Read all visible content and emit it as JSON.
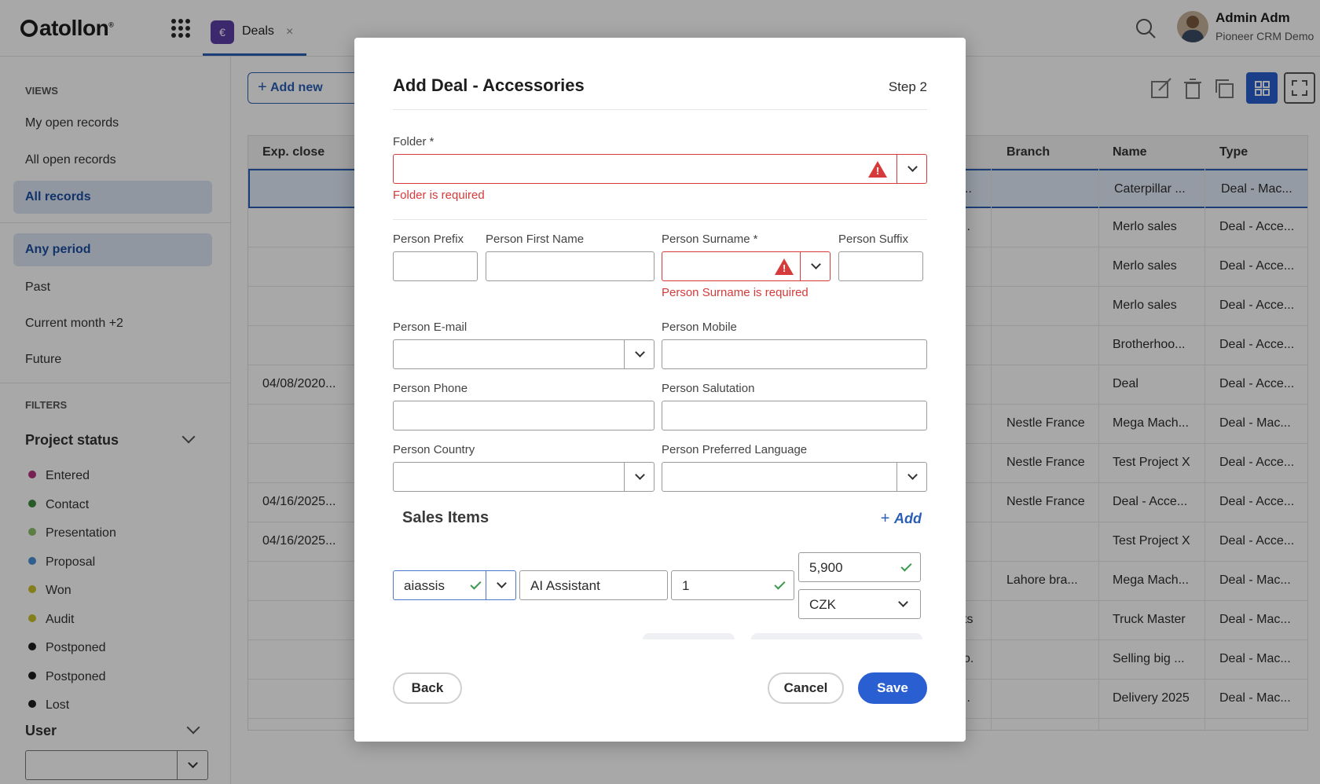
{
  "app": {
    "logo": "atollon",
    "logo_mark": "®",
    "tab_label": "Deals",
    "tab_close": "×",
    "tab_icon_glyph": "€"
  },
  "user": {
    "name": "Admin Adm",
    "org": "Pioneer CRM Demo"
  },
  "sidebar": {
    "views_heading": "VIEWS",
    "views": [
      "My open records",
      "All open records",
      "All records"
    ],
    "period_items": [
      "Any period",
      "Past",
      "Current month +2",
      "Future"
    ],
    "filters_heading": "FILTERS",
    "project_status_title": "Project status",
    "statuses": [
      {
        "label": "Entered",
        "color": "#b5317f"
      },
      {
        "label": "Contact",
        "color": "#3f8a3f"
      },
      {
        "label": "Presentation",
        "color": "#8cc06a"
      },
      {
        "label": "Proposal",
        "color": "#4a90d9"
      },
      {
        "label": "Won",
        "color": "#c9c02a"
      },
      {
        "label": "Audit",
        "color": "#c9c02a"
      },
      {
        "label": "Postponed",
        "color": "#1d1d1d"
      },
      {
        "label": "Postponed",
        "color": "#1d1d1d"
      },
      {
        "label": "Lost",
        "color": "#1d1d1d"
      }
    ],
    "user_filter_title": "User"
  },
  "main": {
    "add_new_label": "Add new",
    "table": {
      "headers": {
        "exp_close": "Exp. close",
        "branch": "Branch",
        "name": "Name",
        "type": "Type"
      },
      "rows": [
        {
          "exp_close": "",
          "mid": "..",
          "branch": "",
          "name": "Caterpillar ...",
          "type": "Deal - Mac..."
        },
        {
          "exp_close": "",
          "mid": "..",
          "branch": "",
          "name": "Merlo sales",
          "type": "Deal - Acce..."
        },
        {
          "exp_close": "",
          "mid": "",
          "branch": "",
          "name": "Merlo sales",
          "type": "Deal - Acce..."
        },
        {
          "exp_close": "",
          "mid": ".",
          "branch": "",
          "name": "Merlo sales",
          "type": "Deal - Acce..."
        },
        {
          "exp_close": "",
          "mid": "",
          "branch": "",
          "name": "Brotherhoo...",
          "type": "Deal - Acce..."
        },
        {
          "exp_close": "04/08/2020...",
          "mid": "",
          "branch": "",
          "name": "Deal",
          "type": "Deal - Acce..."
        },
        {
          "exp_close": "",
          "mid": "",
          "branch": "Nestle France",
          "name": "Mega Mach...",
          "type": "Deal - Mac..."
        },
        {
          "exp_close": "",
          "mid": "",
          "branch": "Nestle France",
          "name": "Test Project X",
          "type": "Deal - Acce..."
        },
        {
          "exp_close": "04/16/2025...",
          "mid": "",
          "branch": "Nestle France",
          "name": "Deal - Acce...",
          "type": "Deal - Acce..."
        },
        {
          "exp_close": "04/16/2025...",
          "mid": "",
          "branch": "",
          "name": "Test Project X",
          "type": "Deal - Acce..."
        },
        {
          "exp_close": "",
          "mid": "",
          "branch": "Lahore bra...",
          "name": "Mega Mach...",
          "type": "Deal - Mac..."
        },
        {
          "exp_close": "",
          "mid": "ts",
          "branch": "",
          "name": "Truck Master",
          "type": "Deal - Mac..."
        },
        {
          "exp_close": "",
          "mid": "o.",
          "branch": "",
          "name": "Selling big ...",
          "type": "Deal - Mac..."
        },
        {
          "exp_close": "",
          "mid": "..",
          "branch": "",
          "name": "Delivery 2025",
          "type": "Deal - Mac..."
        }
      ]
    }
  },
  "modal": {
    "title": "Add Deal - Accessories",
    "step": "Step 2",
    "required_mark": "*",
    "folder": {
      "label": "Folder",
      "value": "",
      "error": "Folder is required"
    },
    "person_prefix": {
      "label": "Person Prefix",
      "value": ""
    },
    "person_first_name": {
      "label": "Person First Name",
      "value": ""
    },
    "person_surname": {
      "label": "Person Surname",
      "value": "",
      "error": "Person Surname is required"
    },
    "person_suffix": {
      "label": "Person Suffix",
      "value": ""
    },
    "person_email": {
      "label": "Person E-mail",
      "value": ""
    },
    "person_mobile": {
      "label": "Person Mobile",
      "value": ""
    },
    "person_phone": {
      "label": "Person Phone",
      "value": ""
    },
    "person_salutation": {
      "label": "Person Salutation",
      "value": ""
    },
    "person_country": {
      "label": "Person Country",
      "value": ""
    },
    "person_preferred_language": {
      "label": "Person Preferred Language",
      "value": ""
    },
    "sales_items": {
      "title": "Sales Items",
      "add_label": "Add",
      "item": {
        "code": "aiassis",
        "name": "AI Assistant",
        "quantity": "1",
        "price": "5,900",
        "currency": "CZK"
      }
    },
    "buttons": {
      "back": "Back",
      "cancel": "Cancel",
      "save": "Save"
    }
  },
  "colors": {
    "accent": "#2a5fd1",
    "error": "#d63a3a",
    "success": "#3a9a4e",
    "selected_nav_bg": "#dce6f5"
  }
}
